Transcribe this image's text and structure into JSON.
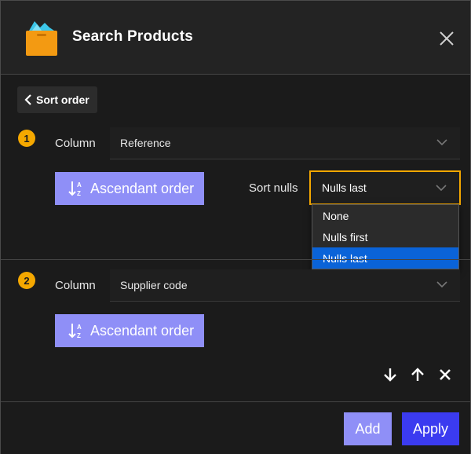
{
  "header": {
    "title": "Search Products",
    "icon": "products-box-icon"
  },
  "back_button": {
    "label": "Sort order"
  },
  "criteria": [
    {
      "number": "1",
      "column_label": "Column",
      "column_value": "Reference",
      "order_label": "Ascendant order",
      "sort_nulls_label": "Sort nulls",
      "sort_nulls_value": "Nulls last"
    },
    {
      "number": "2",
      "column_label": "Column",
      "column_value": "Supplier code",
      "order_label": "Ascendant order"
    }
  ],
  "sort_nulls_dropdown": {
    "options": [
      "None",
      "Nulls first",
      "Nulls last"
    ],
    "selected": "Nulls last"
  },
  "footer": {
    "add_label": "Add",
    "apply_label": "Apply"
  },
  "colors": {
    "accent_badge": "#f5a800",
    "order_button": "#8f8ff7",
    "apply_button": "#3b3bf0",
    "dropdown_highlight": "#0a63d8"
  }
}
